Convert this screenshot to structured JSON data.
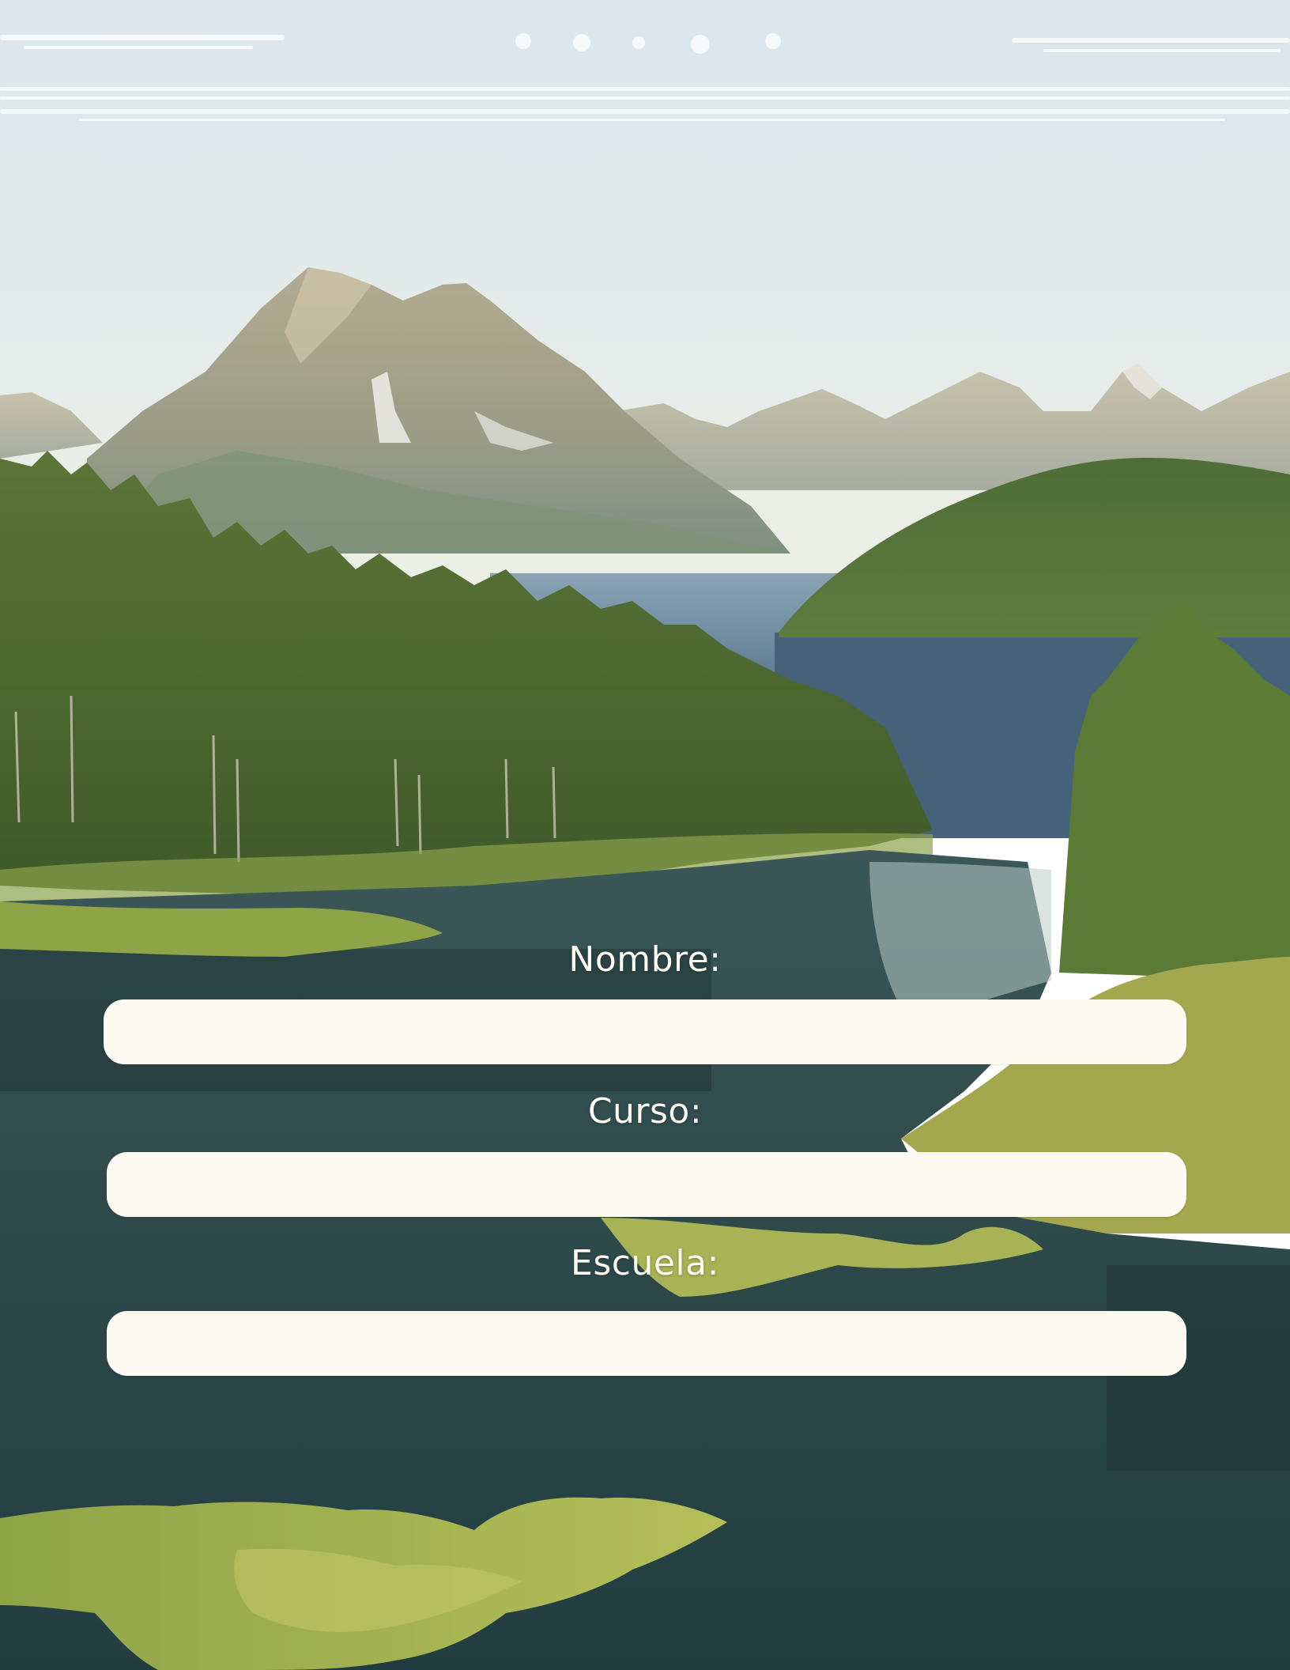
{
  "form": {
    "nombre_label": "Nombre:",
    "nombre_value": "",
    "curso_label": "Curso:",
    "curso_value": "",
    "escuela_label": "Escuela:",
    "escuela_value": ""
  },
  "colors": {
    "sky_top": "#dde7ec",
    "sky_bottom": "#eef0e6",
    "mountain": "#a8a48e",
    "forest": "#4d6a32",
    "lake": "#2f4c4e",
    "lake_light": "#7f9ea3",
    "marsh": "#9fb253",
    "field_fill": "#fdfbf1",
    "label_text": "#fdfbf1"
  },
  "scene": {
    "description_icon": "landscape-illustration"
  }
}
